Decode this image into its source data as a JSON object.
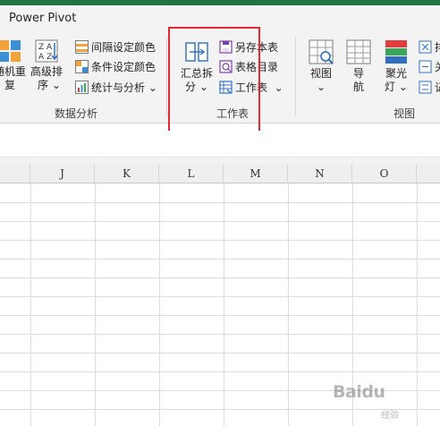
{
  "ribbon_tab": {
    "label": "Power Pivot"
  },
  "group_data_analysis": {
    "label": "数据分析",
    "random_label": [
      "随机重",
      "复"
    ],
    "sort_label": [
      "高级排",
      "序"
    ],
    "interval_color": "间隔设定颜色",
    "cond_color": "条件设定颜色",
    "stats": "统计与分析"
  },
  "group_worksheet": {
    "label": "工作表",
    "split_label": [
      "汇总拆",
      "分"
    ],
    "save_as": "另存本表",
    "toc": "表格目录",
    "worksheet": "工作表"
  },
  "group_view": {
    "label": "视图",
    "view_label": [
      "视图",
      "⌄"
    ],
    "nav_label": [
      "导",
      "航"
    ],
    "spotlight_label": [
      "聚光",
      "灯"
    ],
    "right_items": [
      "排",
      "关",
      "记"
    ]
  },
  "highlight_color": "#e8272e",
  "columns": [
    "J",
    "K",
    "L",
    "M",
    "N",
    "O"
  ],
  "watermark": {
    "logo": "Baidu",
    "sub": "经验"
  }
}
